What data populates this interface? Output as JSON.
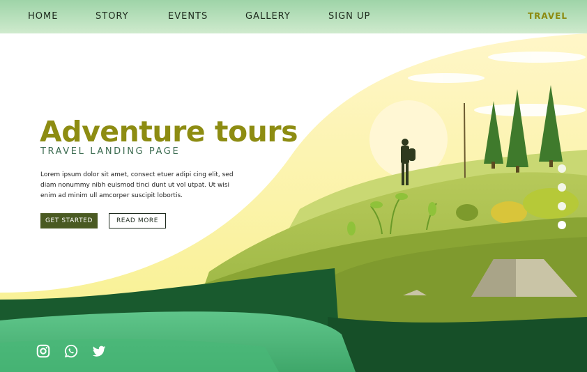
{
  "nav": {
    "items": [
      {
        "label": "HOME"
      },
      {
        "label": "STORY"
      },
      {
        "label": "EVENTS"
      },
      {
        "label": "GALLERY"
      },
      {
        "label": "SIGN UP"
      }
    ],
    "brand": "TRAVEL"
  },
  "hero": {
    "title": "Adventure tours",
    "subtitle": "TRAVEL LANDING PAGE",
    "body": "Lorem ipsum dolor sit amet, consect etuer adipi cing elit, sed diam nonummy nibh euismod tinci dunt ut vol utpat. Ut wisi enim ad minim ull amcorper suscipit lobortis.",
    "primary_button": "GET STARTED",
    "secondary_button": "READ MORE"
  },
  "slider": {
    "count": 4,
    "active_index": 3
  },
  "social": [
    "instagram-icon",
    "whatsapp-icon",
    "twitter-icon"
  ],
  "colors": {
    "title": "#8d8c12",
    "subtitle": "#3b6b50",
    "brand": "#8c8a10",
    "button_primary": "#4a5a22",
    "nav_bar": "#9ed4a8"
  }
}
